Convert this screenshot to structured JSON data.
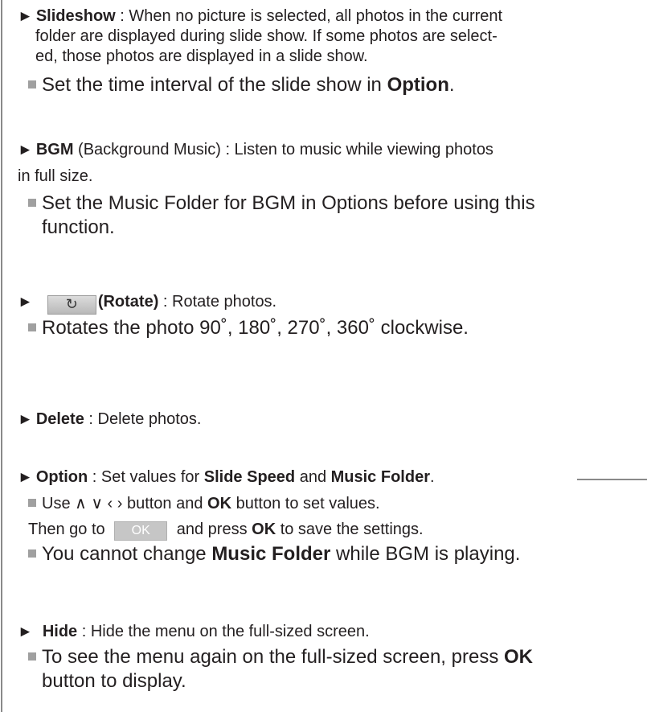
{
  "slideshow": {
    "arrow": "►",
    "title": "Slideshow",
    "text_line1": " : When no picture is selected, all photos in the current",
    "text_line2": "folder are displayed during slide show. If some photos are select-",
    "text_line3": "ed, those photos are displayed in a slide show.",
    "sub_text": "Set the time interval of the slide show in ",
    "sub_bold": "Option",
    "sub_end": "."
  },
  "bgm": {
    "arrow": "►",
    "title": "BGM",
    "text_line1": " (Background Music) : Listen to music while viewing photos",
    "text_line2": "in full size.",
    "sub_line1": "Set the Music Folder for BGM in Options before using this",
    "sub_line2": "function."
  },
  "rotate": {
    "arrow": "►",
    "icon": "rotate-icon",
    "icon_glyph": "↻",
    "title": "(Rotate)",
    "text": " : Rotate photos.",
    "sub_text": "Rotates the photo 90˚, 180˚, 270˚, 360˚ clockwise."
  },
  "delete": {
    "arrow": "►",
    "title": "Delete",
    "text": " : Delete photos."
  },
  "option": {
    "arrow": "►",
    "title": "Option",
    "text_a": " : Set values for ",
    "bold_a": "Slide Speed",
    "text_b": " and ",
    "bold_b": "Music Folder",
    "text_c": ".",
    "sub1_text": "Use ∧ ∨ ‹ › button and ",
    "sub1_bold": "OK",
    "sub1_end": " button to set values.",
    "line2_a": "Then go to ",
    "ok_chip": "OK",
    "line2_b": " and press ",
    "line2_bold": "OK",
    "line2_c": " to save the settings.",
    "sub2_a": "You cannot change ",
    "sub2_bold": "Music Folder",
    "sub2_b": " while BGM is playing."
  },
  "hide": {
    "arrow": "►",
    "title": "Hide",
    "text": " : Hide the menu on the full-sized screen.",
    "sub_a": "To see the menu again on the full-sized screen, press ",
    "sub_bold": "OK",
    "sub_line2": "button to display."
  },
  "colors": {
    "text": "#231f20",
    "bullet_square": "#a0a0a0",
    "rule": "#8a8a8a",
    "ok_chip_bg": "#c6c6c6"
  }
}
